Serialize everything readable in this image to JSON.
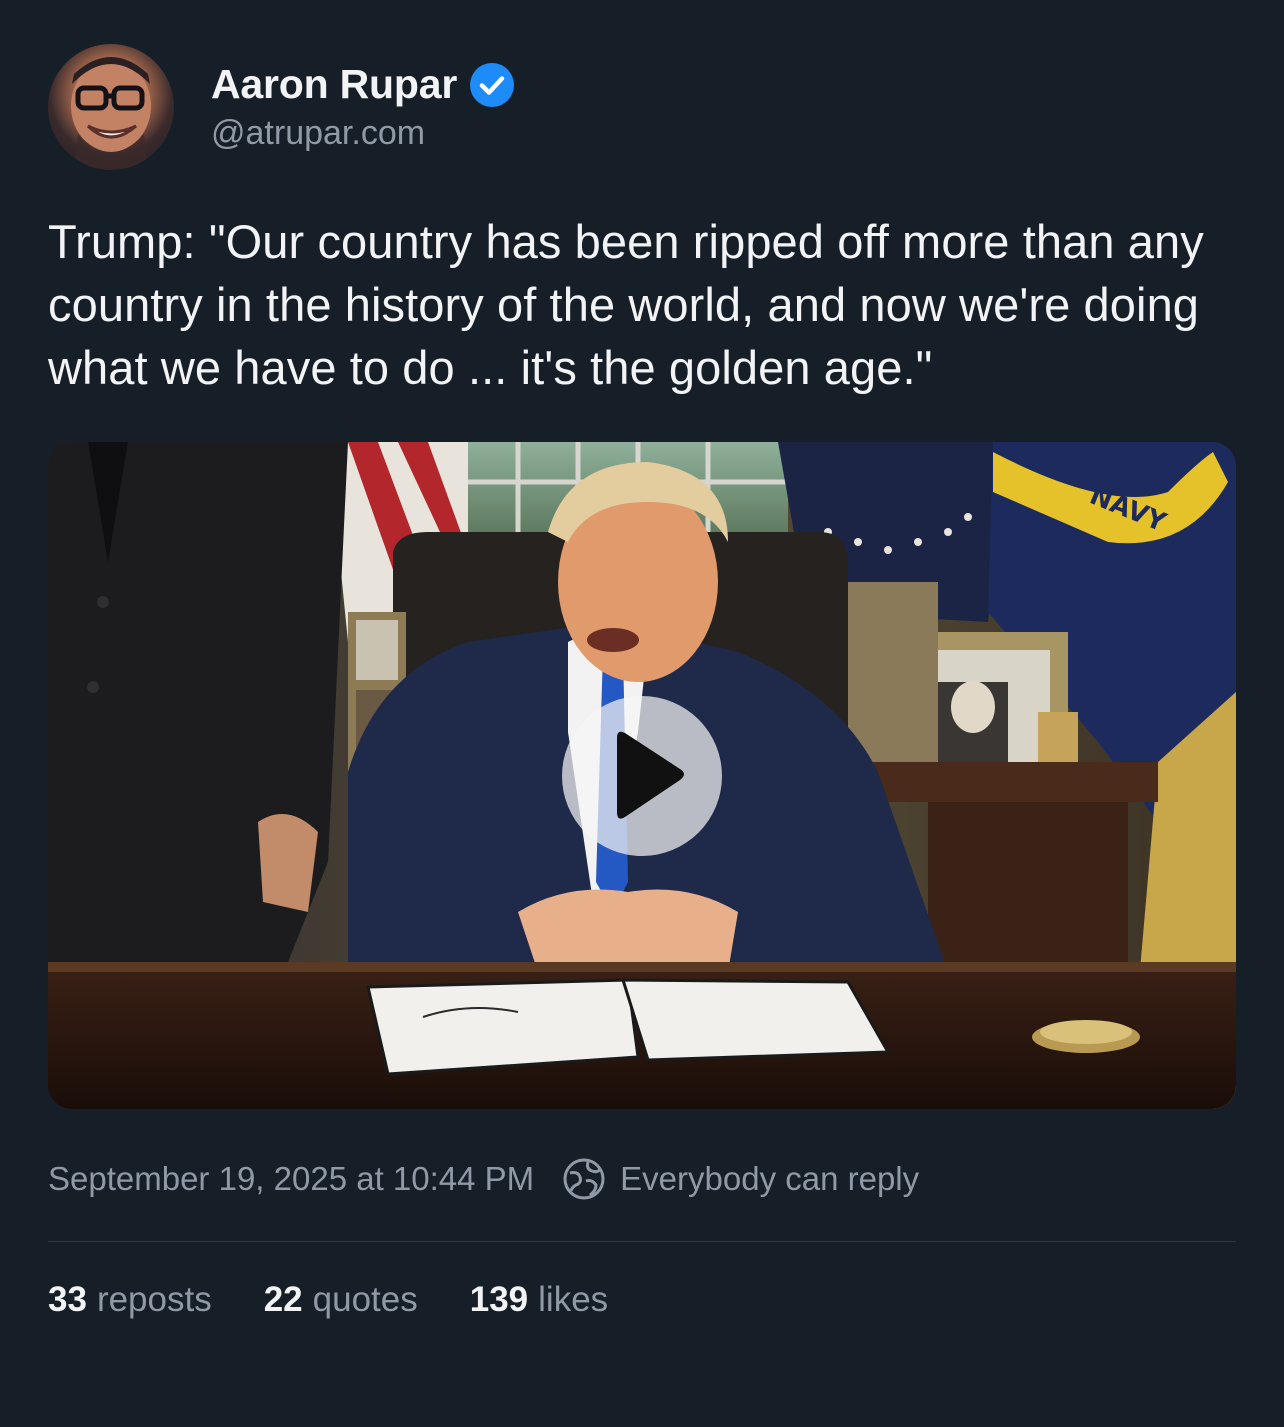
{
  "author": {
    "display_name": "Aaron Rupar",
    "handle": "@atrupar.com",
    "verified": true,
    "verified_color": "#1d8cf8"
  },
  "post": {
    "text": "Trump: \"Our country has been ripped off more than any country in the history of the world, and now we're doing what we have to do ... it's the golden age.\"",
    "timestamp": "September 19, 2025 at 10:44 PM",
    "reply_setting": "Everybody can reply"
  },
  "media": {
    "type": "video",
    "flag_text": "NAVY",
    "play_icon": "play-icon"
  },
  "stats": {
    "reposts": {
      "count": "33",
      "label": "reposts"
    },
    "quotes": {
      "count": "22",
      "label": "quotes"
    },
    "likes": {
      "count": "139",
      "label": "likes"
    }
  },
  "colors": {
    "background": "#161e27",
    "text_primary": "#f1f3f5",
    "text_secondary": "#8f9aa6"
  }
}
